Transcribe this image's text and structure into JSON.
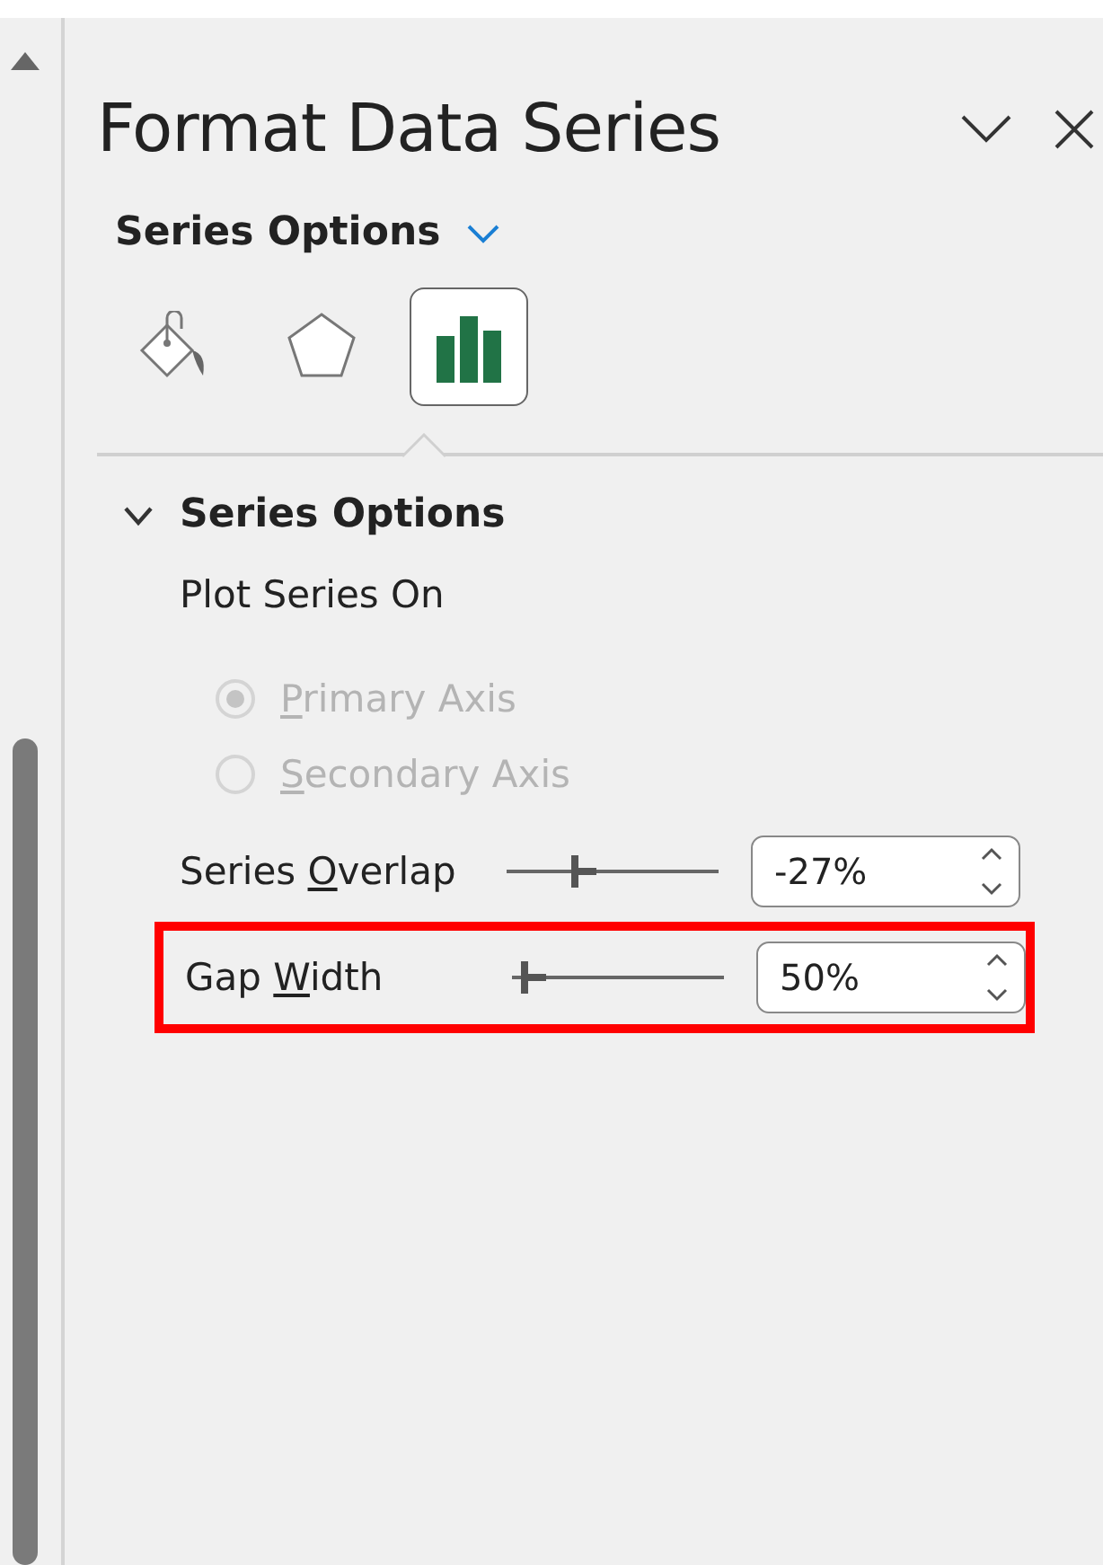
{
  "pane": {
    "title": "Format Data Series",
    "options_menu": "Series Options"
  },
  "tabs": [
    {
      "kind": "fill",
      "selected": false
    },
    {
      "kind": "effects",
      "selected": false
    },
    {
      "kind": "series",
      "selected": true
    }
  ],
  "section": {
    "title": "Series Options",
    "expanded": true,
    "subheading": "Plot Series On",
    "radios": [
      {
        "key": "P",
        "after": "rimary Axis",
        "selected": true,
        "disabled": true
      },
      {
        "key": "S",
        "after": "econdary Axis",
        "selected": false,
        "disabled": true
      }
    ],
    "sliders": [
      {
        "before": "Series ",
        "key": "O",
        "after": "verlap",
        "level": 0.365,
        "value": "-27%",
        "highlighted": false
      },
      {
        "before": "Gap ",
        "key": "W",
        "after": "idth",
        "level": 0.07,
        "value": "50%",
        "highlighted": true
      }
    ]
  }
}
